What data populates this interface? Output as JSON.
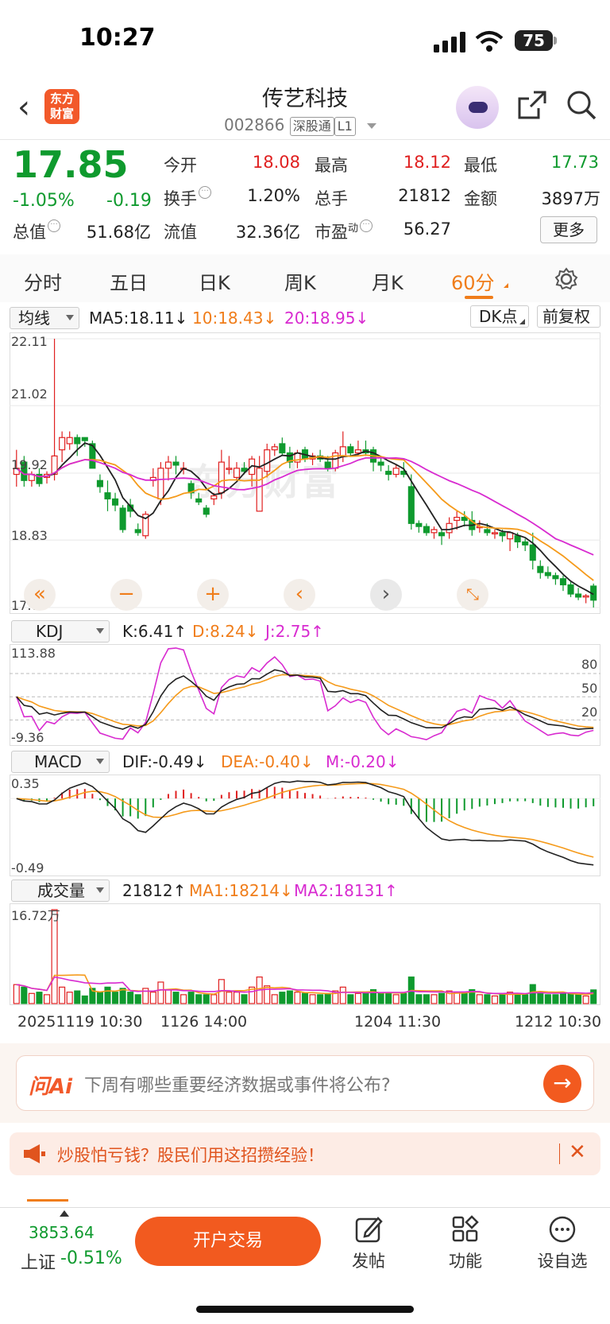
{
  "status_bar": {
    "time": "10:27",
    "battery": "75"
  },
  "header": {
    "logo_line1": "东方",
    "logo_line2": "财富",
    "stock_name": "传艺科技",
    "stock_code": "002866",
    "tag_market": "深股通",
    "tag_level": "L1"
  },
  "quote": {
    "price": "17.85",
    "change_pct": "-1.05%",
    "change_val": "-0.19",
    "open_label": "今开",
    "open": "18.08",
    "high_label": "最高",
    "high": "18.12",
    "low_label": "最低",
    "low": "17.73",
    "turnover_label": "换手",
    "turnover": "1.20%",
    "volume_label": "总手",
    "volume": "21812",
    "amount_label": "金额",
    "amount": "3897万",
    "mcap_label": "总值",
    "mcap": "51.68亿",
    "float_label": "流值",
    "float_cap": "32.36亿",
    "pe_label": "市盈",
    "pe_sup": "动",
    "pe": "56.27",
    "more_label": "更多"
  },
  "tabs": [
    "分时",
    "五日",
    "日K",
    "周K",
    "月K",
    "60分"
  ],
  "active_tab": "60分",
  "kline_header": {
    "ma_selector": "均线",
    "ma5": "MA5:18.11↓",
    "ma10": "10:18.43↓",
    "ma20": "20:18.95↓",
    "dk_label": "DK点",
    "adjust_label": "前复权"
  },
  "kline_axis": {
    "top": "22.11",
    "l2": "21.02",
    "l3": "19.92",
    "l4": "18.83",
    "bottom": "17.73"
  },
  "kdj_header": {
    "selector": "KDJ",
    "k": "K:6.41↑",
    "d": "D:8.24↓",
    "j": "J:2.75↑"
  },
  "kdj_axis": {
    "top": "113.88",
    "bottom": "-9.36",
    "r80": "80",
    "r50": "50",
    "r20": "20"
  },
  "macd_header": {
    "selector": "MACD",
    "dif": "DIF:-0.49↓",
    "dea": "DEA:-0.40↓",
    "m": "M:-0.20↓"
  },
  "macd_axis": {
    "top": "0.35",
    "bottom": "-0.49"
  },
  "vol_header": {
    "selector": "成交量",
    "vol": "21812↑",
    "ma1": "MA1:18214↓",
    "ma2": "MA2:18131↑"
  },
  "vol_axis": {
    "top": "16.72万"
  },
  "time_axis": [
    "20251119 10:30",
    "1126 14:00",
    "1204 11:30",
    "1212 10:30"
  ],
  "watermark": "东方财富",
  "ai": {
    "logo": "问Ai",
    "prompt": "下周有哪些重要经济数据或事件将公布?"
  },
  "promo": {
    "text": "炒股怕亏钱？股民们用这招攒经验！"
  },
  "bottom_nav": {
    "index_value": "3853.64",
    "index_name": "上证",
    "index_change": "-0.51%",
    "trade_label": "开户交易",
    "post_label": "发帖",
    "func_label": "功能",
    "watch_label": "设自选"
  },
  "colors": {
    "up": "#e02020",
    "down": "#0f9a2e",
    "ma5": "#222222",
    "ma10": "#f59a1a",
    "ma20": "#d82bd0",
    "accent": "#f25a1f"
  },
  "chart_data": [
    {
      "type": "candlestick",
      "title": "60分",
      "ylim": [
        17.73,
        22.11
      ],
      "y_ticks": [
        22.11,
        21.02,
        19.92,
        18.83,
        17.73
      ],
      "candles": [
        [
          19.9,
          20.3,
          19.7,
          20.0
        ],
        [
          20.1,
          20.2,
          19.7,
          19.8
        ],
        [
          19.8,
          19.95,
          19.7,
          19.9
        ],
        [
          19.9,
          20.0,
          19.7,
          19.75
        ],
        [
          19.85,
          19.95,
          19.75,
          19.9
        ],
        [
          19.9,
          22.11,
          19.8,
          20.2
        ],
        [
          20.3,
          20.6,
          20.1,
          20.5
        ],
        [
          20.4,
          20.6,
          20.3,
          20.5
        ],
        [
          20.5,
          20.55,
          20.2,
          20.4
        ],
        [
          20.5,
          20.5,
          20.35,
          20.45
        ],
        [
          20.4,
          20.45,
          20.0,
          20.0
        ],
        [
          19.8,
          19.9,
          19.6,
          19.7
        ],
        [
          19.6,
          19.8,
          19.3,
          19.5
        ],
        [
          19.5,
          19.6,
          19.3,
          19.4
        ],
        [
          19.35,
          19.4,
          18.95,
          19.0
        ],
        [
          19.4,
          19.5,
          19.2,
          19.3
        ],
        [
          19.0,
          19.1,
          18.9,
          18.95
        ],
        [
          18.9,
          19.3,
          18.85,
          19.25
        ],
        [
          19.8,
          20.0,
          19.7,
          19.85
        ],
        [
          19.5,
          20.1,
          19.4,
          20.0
        ],
        [
          20.0,
          20.2,
          19.8,
          20.1
        ],
        [
          20.1,
          20.2,
          19.9,
          20.05
        ],
        [
          20.0,
          20.1,
          19.9,
          20.0
        ],
        [
          19.75,
          19.8,
          19.5,
          19.6
        ],
        [
          19.5,
          19.6,
          19.4,
          19.45
        ],
        [
          19.35,
          19.4,
          19.2,
          19.25
        ],
        [
          19.5,
          19.6,
          19.4,
          19.55
        ],
        [
          19.6,
          20.3,
          19.5,
          20.1
        ],
        [
          20.0,
          20.2,
          19.9,
          20.0
        ],
        [
          19.85,
          20.1,
          19.8,
          20.0
        ],
        [
          20.0,
          20.1,
          19.9,
          19.95
        ],
        [
          19.9,
          20.2,
          19.7,
          20.15
        ],
        [
          19.3,
          20.2,
          19.3,
          20.0
        ],
        [
          19.95,
          20.4,
          19.85,
          20.3
        ],
        [
          20.3,
          20.4,
          20.2,
          20.35
        ],
        [
          20.4,
          20.5,
          20.2,
          20.25
        ],
        [
          20.25,
          20.35,
          20.0,
          20.1
        ],
        [
          20.1,
          20.3,
          20.0,
          20.25
        ],
        [
          20.3,
          20.35,
          20.1,
          20.15
        ],
        [
          20.15,
          20.25,
          20.05,
          20.2
        ],
        [
          20.2,
          20.3,
          20.1,
          20.15
        ],
        [
          20.1,
          20.2,
          19.95,
          20.0
        ],
        [
          20.0,
          20.3,
          19.95,
          20.25
        ],
        [
          20.2,
          20.6,
          20.1,
          20.35
        ],
        [
          20.35,
          20.4,
          20.2,
          20.25
        ],
        [
          20.25,
          20.45,
          20.2,
          20.3
        ],
        [
          20.3,
          20.45,
          20.2,
          20.25
        ],
        [
          20.3,
          20.35,
          19.95,
          20.1
        ],
        [
          20.1,
          20.2,
          19.95,
          20.05
        ],
        [
          19.95,
          20.05,
          19.8,
          19.9
        ],
        [
          19.9,
          20.05,
          19.85,
          20.0
        ],
        [
          19.95,
          20.1,
          19.85,
          19.9
        ],
        [
          19.7,
          19.9,
          19.0,
          19.1
        ],
        [
          19.1,
          19.15,
          18.95,
          19.05
        ],
        [
          19.05,
          19.1,
          18.9,
          18.95
        ],
        [
          18.95,
          19.05,
          18.85,
          19.0
        ],
        [
          18.95,
          19.0,
          18.75,
          18.9
        ],
        [
          18.95,
          19.2,
          18.85,
          19.1
        ],
        [
          19.15,
          19.3,
          19.0,
          19.2
        ],
        [
          19.2,
          19.3,
          19.05,
          19.15
        ],
        [
          19.15,
          19.3,
          18.9,
          19.0
        ],
        [
          19.05,
          19.15,
          18.95,
          19.05
        ],
        [
          19.0,
          19.1,
          18.9,
          18.95
        ],
        [
          18.95,
          19.0,
          18.85,
          18.95
        ],
        [
          18.95,
          19.0,
          18.8,
          18.9
        ],
        [
          18.85,
          18.95,
          18.65,
          18.95
        ],
        [
          18.9,
          18.95,
          18.7,
          18.8
        ],
        [
          18.8,
          18.85,
          18.65,
          18.75
        ],
        [
          18.75,
          18.95,
          18.35,
          18.5
        ],
        [
          18.4,
          18.5,
          18.2,
          18.3
        ],
        [
          18.3,
          18.4,
          18.2,
          18.25
        ],
        [
          18.25,
          18.3,
          18.1,
          18.2
        ],
        [
          18.2,
          18.25,
          18.0,
          18.1
        ],
        [
          18.1,
          18.15,
          17.9,
          17.95
        ],
        [
          17.95,
          18.05,
          17.85,
          17.9
        ],
        [
          17.9,
          17.95,
          17.8,
          17.92
        ],
        [
          18.08,
          18.12,
          17.73,
          17.85
        ]
      ]
    },
    {
      "type": "line",
      "title": "KDJ",
      "ylim": [
        -9.36,
        113.88
      ],
      "series": [
        {
          "name": "K",
          "last": 6.41
        },
        {
          "name": "D",
          "last": 8.24
        },
        {
          "name": "J",
          "last": 2.75
        }
      ]
    },
    {
      "type": "bar",
      "title": "MACD",
      "ylim": [
        -0.49,
        0.35
      ],
      "series": [
        {
          "name": "DIF",
          "last": -0.49
        },
        {
          "name": "DEA",
          "last": -0.4
        },
        {
          "name": "M",
          "last": -0.2
        }
      ]
    },
    {
      "type": "bar",
      "title": "成交量",
      "ylim": [
        0,
        167200
      ],
      "series": [
        {
          "name": "VOL",
          "last": 21812
        },
        {
          "name": "MA1",
          "last": 18214
        },
        {
          "name": "MA2",
          "last": 18131
        }
      ]
    }
  ]
}
